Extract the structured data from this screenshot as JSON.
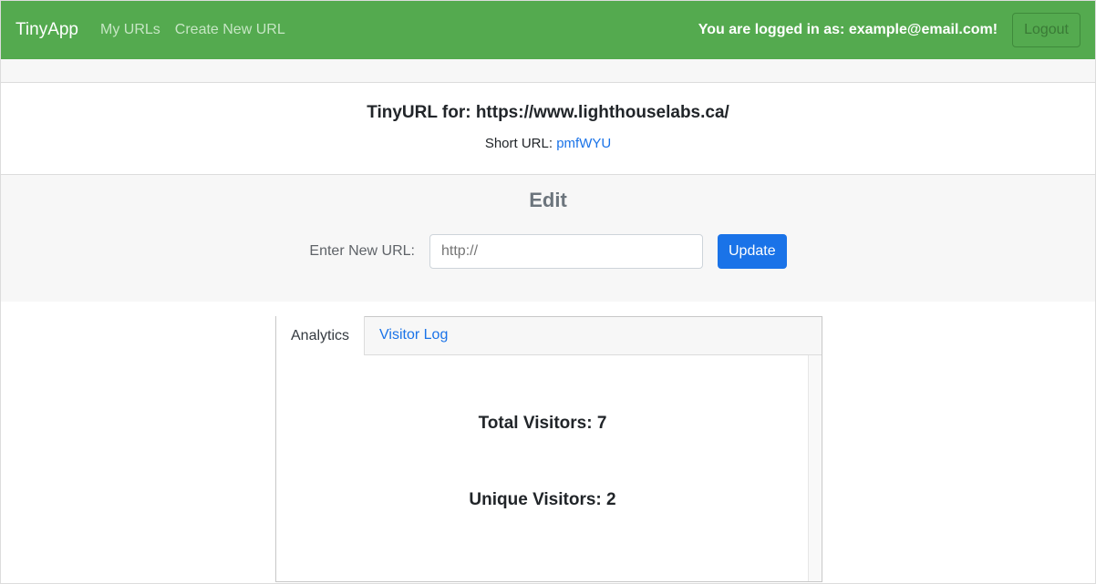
{
  "navbar": {
    "brand": "TinyApp",
    "links": [
      "My URLs",
      "Create New URL"
    ],
    "login_text": "You are logged in as: example@email.com!",
    "logout_label": "Logout"
  },
  "info": {
    "title": "TinyURL for: https://www.lighthouselabs.ca/",
    "short_label": "Short URL:",
    "short_code": "pmfWYU"
  },
  "edit": {
    "title": "Edit",
    "label": "Enter New URL:",
    "input_placeholder": "http://",
    "update_label": "Update"
  },
  "tabs": [
    {
      "label": "Analytics",
      "active": true
    },
    {
      "label": "Visitor Log",
      "active": false
    }
  ],
  "analytics": {
    "total_visitors": "Total Visitors: 7",
    "unique_visitors": "Unique Visitors: 2"
  }
}
